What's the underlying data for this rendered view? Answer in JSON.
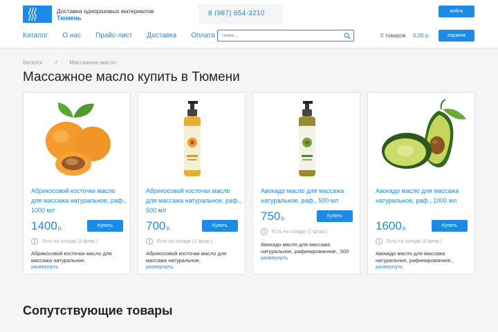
{
  "header": {
    "tagline": "Доставка одноразовых материалов",
    "city": "Тюмень",
    "phone": "8 (987) 654-3210",
    "login_label": "войти",
    "search_placeholder": "Поиск...",
    "cart_count": "0",
    "cart_count_label": "товаров",
    "cart_sum": "0.00 р.",
    "cart_label": "корзина",
    "accent_color": "#1d8ae6"
  },
  "nav": {
    "items": [
      "Каталог",
      "О нас",
      "Прайс-лист",
      "Доставка",
      "Оплата"
    ]
  },
  "breadcrumb": {
    "items": [
      "Каталог",
      "Массажное масло"
    ],
    "separator": "/"
  },
  "page_title": "Массажное масло купить в Тюмени",
  "products": [
    {
      "name": "Абрикосовой косточки масло для массажа натуральное, раф., 1000 мл",
      "price": "1400",
      "currency": "р.",
      "buy_label": "Купить",
      "stock": "Есть на складе (3 флак.)",
      "description": "Абрикосовой косточки масло для массажа натуральное,",
      "expand_label": "развернуть",
      "image": "apricot-image"
    },
    {
      "name": "Абрикосовой косточки масло для массажа натуральное, раф., 500 мл",
      "price": "700",
      "currency": "р.",
      "buy_label": "Купить",
      "stock": "Есть на складе (1 флак.)",
      "description": "Абрикосовой косточки масло для массажа натуральное,",
      "expand_label": "развернуть",
      "image": "oil-bottle-image"
    },
    {
      "name": "Авокадо масло для массажа натуральное, раф., 500 мл",
      "price": "750",
      "currency": "р.",
      "buy_label": "Купить",
      "stock": "Есть на складе (1 флак.)",
      "description": "Авокадо масло для массажа натуральное, рафинированное., 500",
      "expand_label": "развернуть",
      "image": "oil-bottle-image"
    },
    {
      "name": "Авокадо масло для массажа натуральное, раф., 1000 мл",
      "price": "1600",
      "currency": "р.",
      "buy_label": "Купить",
      "stock": "Есть на складе (3 флак.)",
      "description": "Авокадо масло для массажа натуральное, рафинированное.,",
      "expand_label": "развернуть",
      "image": "avocado-image"
    }
  ],
  "related_title": "Сопутствующие товары"
}
